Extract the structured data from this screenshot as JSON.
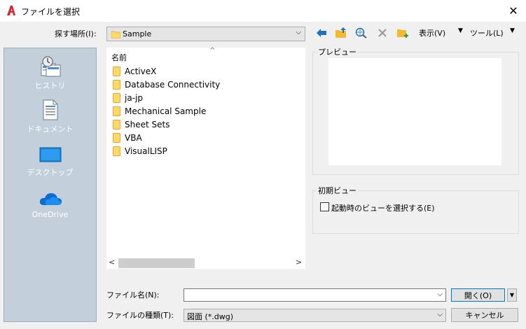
{
  "window": {
    "title": "ファイルを選択",
    "close_glyph": "✕"
  },
  "lookin": {
    "label": "探す場所(I):",
    "value": "Sample",
    "arrow": "⌵"
  },
  "toolbar": {
    "view_label": "表示(V)",
    "tools_label": "ツール(L)",
    "dropdown_glyph": "▼"
  },
  "places": [
    {
      "label": "ヒストリ",
      "icon": "history-icon"
    },
    {
      "label": "ドキュメント",
      "icon": "document-icon"
    },
    {
      "label": "デスクトップ",
      "icon": "desktop-icon"
    },
    {
      "label": "OneDrive",
      "icon": "onedrive-icon"
    }
  ],
  "filelist": {
    "column_header": "名前",
    "sort_glyph": "^",
    "items": [
      "ActiveX",
      "Database Connectivity",
      "ja-jp",
      "Mechanical Sample",
      "Sheet Sets",
      "VBA",
      "VisualLISP"
    ],
    "scroll_left": "<",
    "scroll_right": ">"
  },
  "preview": {
    "label": "プレビュー"
  },
  "initial_view": {
    "label": "初期ビュー",
    "checkbox_label": "起動時のビューを選択する(E)",
    "checked": false
  },
  "filename": {
    "label": "ファイル名(N):",
    "value": "",
    "arrow": "⌵"
  },
  "filetype": {
    "label": "ファイルの種類(T):",
    "value": "図面 (*.dwg)",
    "arrow": "⌵"
  },
  "buttons": {
    "open": "開く(O)",
    "open_dropdown": "▼",
    "cancel": "キャンセル"
  },
  "colors": {
    "accent": "#0078d7",
    "places_bg": "#c3cfdb",
    "folder_yellow": "#ffd866",
    "app_red": "#d6262d"
  }
}
